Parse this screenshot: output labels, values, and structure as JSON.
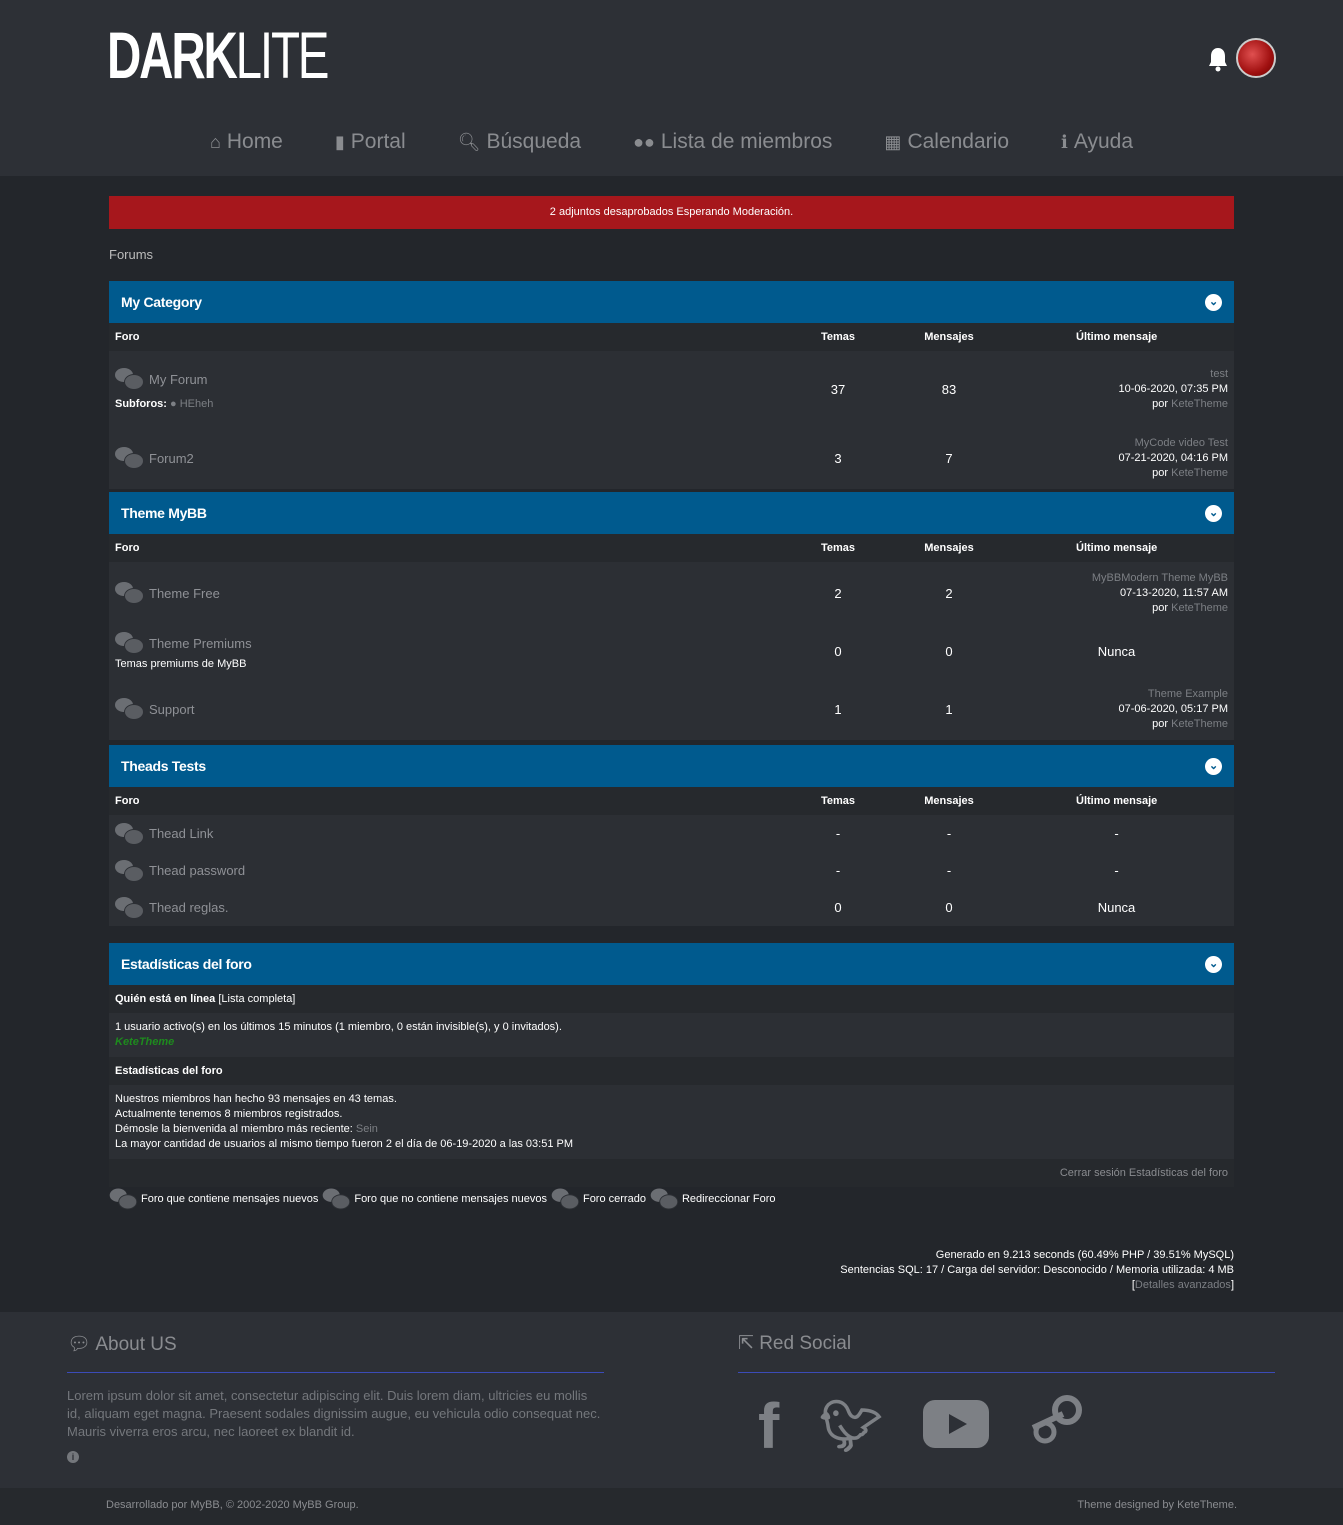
{
  "header": {
    "logo_bold": "DARK",
    "logo_light": "LITE"
  },
  "nav": [
    {
      "icon": "home-icon",
      "label": "Home"
    },
    {
      "icon": "file-icon",
      "label": "Portal"
    },
    {
      "icon": "search-icon",
      "label": "Búsqueda"
    },
    {
      "icon": "users-icon",
      "label": "Lista de miembros"
    },
    {
      "icon": "calendar-icon",
      "label": "Calendario"
    },
    {
      "icon": "info-icon",
      "label": "Ayuda"
    }
  ],
  "alert": {
    "text": "2 adjuntos desaprobados ",
    "strong": "Esperando Moderación."
  },
  "breadcrumb": "Forums",
  "columns": {
    "forum": "Foro",
    "topics": "Temas",
    "posts": "Mensajes",
    "last": "Último mensaje"
  },
  "categories": [
    {
      "title": "My Category",
      "forums": [
        {
          "name": "My Forum",
          "subforums_label": "Subforos:",
          "subforum": "HEheh",
          "topics": "37",
          "posts": "83",
          "last_title": "test",
          "last_date": "10-06-2020, 07:35 PM",
          "by": "por",
          "last_user": "KeteTheme"
        },
        {
          "name": "Forum2",
          "topics": "3",
          "posts": "7",
          "last_title": "MyCode video Test",
          "last_date": "07-21-2020, 04:16 PM",
          "by": "por",
          "last_user": "KeteTheme"
        }
      ]
    },
    {
      "title": "Theme MyBB",
      "forums": [
        {
          "name": "Theme Free",
          "topics": "2",
          "posts": "2",
          "last_title": "MyBBModern Theme MyBB",
          "last_date": "07-13-2020, 11:57 AM",
          "by": "por",
          "last_user": "KeteTheme"
        },
        {
          "name": "Theme Premiums",
          "desc": "Temas premiums de MyBB",
          "topics": "0",
          "posts": "0",
          "never": "Nunca"
        },
        {
          "name": "Support",
          "topics": "1",
          "posts": "1",
          "last_title": "Theme Example",
          "last_date": "07-06-2020, 05:17 PM",
          "by": "por",
          "last_user": "KeteTheme"
        }
      ]
    },
    {
      "title": "Theads Tests",
      "forums": [
        {
          "name": "Thead Link",
          "topics": "-",
          "posts": "-",
          "never": "-"
        },
        {
          "name": "Thead password",
          "topics": "-",
          "posts": "-",
          "never": "-"
        },
        {
          "name": "Thead reglas.",
          "topics": "0",
          "posts": "0",
          "never": "Nunca"
        }
      ]
    }
  ],
  "stats": {
    "title": "Estadísticas del foro",
    "online_h": "Quién está en línea",
    "online_link": "[Lista completa]",
    "online_text": "1 usuario activo(s) en los últimos 15 minutos (1 miembro, 0 están invisible(s), y 0 invitados).",
    "online_user": "KeteTheme",
    "stats_h": "Estadísticas del foro",
    "l1": "Nuestros miembros han hecho 93 mensajes en 43 temas.",
    "l2": "Actualmente tenemos 8 miembros registrados.",
    "l3": "Démosle la bienvenida al miembro más reciente: ",
    "newest": "Sein",
    "l4": "La mayor cantidad de usuarios al mismo tiempo fueron 2 el día de 06-19-2020 a las 03:51 PM",
    "logout": "Cerrar sesión Estadísticas del foro"
  },
  "legend": [
    "Foro que contiene mensajes nuevos",
    "Foro que no contiene mensajes nuevos",
    "Foro cerrado",
    "Redireccionar Foro"
  ],
  "debug": {
    "l1": "Generado en 9.213 seconds (60.49% PHP / 39.51% MySQL)",
    "l2": "Sentencias SQL: 17 / Carga del servidor: Desconocido / Memoria utilizada: 4 MB",
    "open": "[",
    "link": "Detalles avanzados",
    "close": "]"
  },
  "footer": {
    "about_title": "About US",
    "about_text": "Lorem ipsum dolor sit amet, consectetur adipiscing elit. Duis lorem diam, ultricies eu mollis id, aliquam eget magna. Praesent sodales dignissim augue, eu vehicula odio consequat nec. Mauris viverra eros arcu, nec laoreet ex blandit id.",
    "social_title": "Red Social",
    "social": [
      "facebook-icon",
      "twitter-icon",
      "youtube-icon",
      "steam-icon"
    ],
    "credit_left": "Desarrollado por MyBB, © 2002-2020 MyBB Group.",
    "credit_right": "Theme designed by KeteTheme."
  }
}
